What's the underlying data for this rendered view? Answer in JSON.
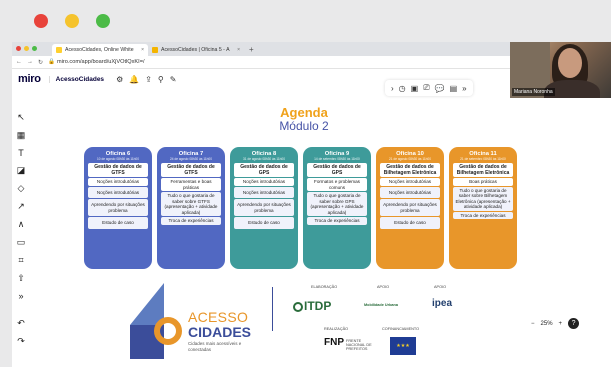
{
  "colors": {
    "traffic_red": "#e8433b",
    "traffic_yellow": "#f5c32d",
    "traffic_green": "#4cbb47",
    "title_orange": "#f0a21b",
    "title_blue": "#4653a6",
    "card_blue": "#5168c2",
    "card_teal": "#3e9b9a",
    "card_orange": "#e8962a"
  },
  "browser": {
    "tabs": [
      {
        "label": "AcessoCidades, Online White",
        "close": "×",
        "icon": "miro-favicon"
      },
      {
        "label": "AcessoCidades | Oficina 5 - A",
        "close": "×",
        "icon": "chart-favicon"
      }
    ],
    "new_tab": "+",
    "url": "miro.com/app/board/uXjVOtlQxKI=/"
  },
  "miro": {
    "logo": "miro",
    "board_name": "AcessoCidades"
  },
  "webcam": {
    "name": "Mariana Noronha"
  },
  "board": {
    "title": "Agenda",
    "subtitle": "Módulo 2",
    "cards": [
      {
        "title": "Oficina 6",
        "date": "10 de agosto\n08h30 às 11h00",
        "color": "#5168c2",
        "items": [
          "Gestão de dados de GTFS",
          "Noções introdutórias",
          "Noções introdutórias",
          "Aprendendo por situações problema",
          "Estudo de caso"
        ]
      },
      {
        "title": "Oficina 7",
        "date": "24 de agosto\n08h30 às 11h00",
        "color": "#5168c2",
        "items": [
          "Gestão de dados de GTFS",
          "Ferramentas e boas práticas",
          "Tudo o que gostaria de saber sobre GTFS (apresentação + atividade aplicada)",
          "Troca de experiências"
        ]
      },
      {
        "title": "Oficina 8",
        "date": "31 de agosto\n08h30 às 11h00",
        "color": "#3e9b9a",
        "items": [
          "Gestão de dados de GPS",
          "Noções introdutórias",
          "Noções introdutórias",
          "Aprendendo por situações problema",
          "Estudo de caso"
        ]
      },
      {
        "title": "Oficina 9",
        "date": "14 de setembro\n08h30 às 11h00",
        "color": "#3e9b9a",
        "items": [
          "Gestão de dados de GPS",
          "Formatos e problemas comuns",
          "Tudo o que gostaria de saber sobre GPS (apresentação + atividade aplicada)",
          "Troca de experiências"
        ]
      },
      {
        "title": "Oficina 10",
        "date": "21 de agosto\n08h30 às 11h00",
        "color": "#e8962a",
        "items": [
          "Gestão de dados de Bilhetagem Eletrônica",
          "Noções introdutórias",
          "Noções introdutórias",
          "Aprendendo por situações problema",
          "Estudo de caso"
        ]
      },
      {
        "title": "Oficina 11",
        "date": "21 de setembro\n08h30 às 11h00",
        "color": "#e8962a",
        "items": [
          "Gestão de dados de Bilhetagem Eletrônica",
          "Boas práticas",
          "Tudo o que gostaria de saber sobre Bilhetagem Eletrônica (apresentação + atividade aplicada)",
          "Troca de experiências"
        ]
      }
    ]
  },
  "logos": {
    "acesso_word1": "ACESSO",
    "acesso_word2": "CIDADES",
    "acesso_tagline": "Cidades mais acessíveis e conectadas",
    "label_elaboracao": "ELABORAÇÃO",
    "label_apoio1": "APOIO",
    "label_apoio2": "APOIO",
    "label_realizacao": "REALIZAÇÃO",
    "label_cofinanciamento": "COFINANCIAMENTO",
    "itdp": "ITDP",
    "mobilidade": "Mobilidade Urbana",
    "ipea": "ipea",
    "fnp": "FNP",
    "fnp_sub": "FRENTE NACIONAL DE PREFEITOS"
  },
  "zoom": {
    "minus": "−",
    "value": "25%",
    "plus": "+",
    "help": "?"
  }
}
